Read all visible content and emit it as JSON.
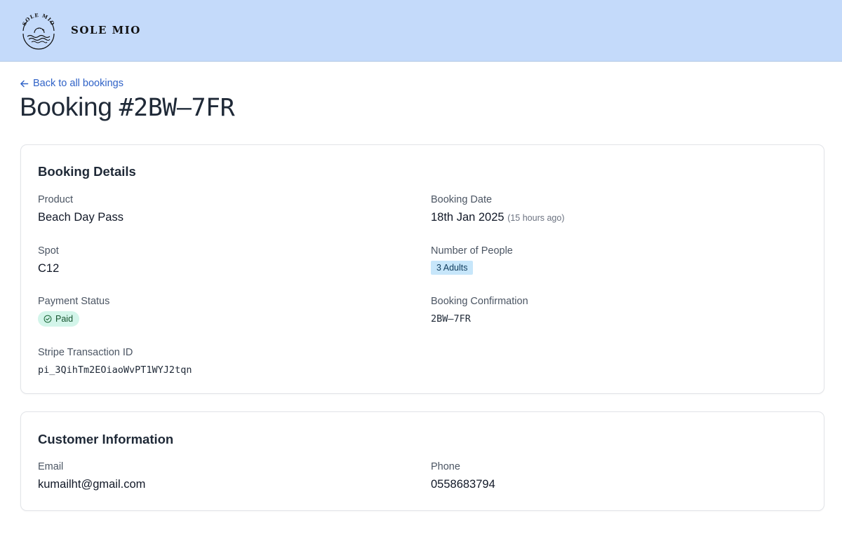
{
  "header": {
    "brand": "SOLE MIO",
    "logo_text": "SOLE MIO"
  },
  "nav": {
    "back_label": "Back to all bookings"
  },
  "page": {
    "title_prefix": "Booking ",
    "title_id": "#2BW–7FR"
  },
  "booking_details": {
    "title": "Booking Details",
    "product_label": "Product",
    "product_value": "Beach Day Pass",
    "booking_date_label": "Booking Date",
    "booking_date_value": "18th Jan 2025",
    "booking_date_relative": "(15 hours ago)",
    "spot_label": "Spot",
    "spot_value": "C12",
    "people_label": "Number of People",
    "people_value": "3 Adults",
    "payment_label": "Payment Status",
    "payment_value": "Paid",
    "confirmation_label": "Booking Confirmation",
    "confirmation_value": "2BW–7FR",
    "stripe_label": "Stripe Transaction ID",
    "stripe_value": "pi_3QihTm2EOiaoWvPT1WYJ2tqn"
  },
  "customer_info": {
    "title": "Customer Information",
    "email_label": "Email",
    "email_value": "kumailht@gmail.com",
    "phone_label": "Phone",
    "phone_value": "0558683794"
  },
  "colors": {
    "header_bg": "#c4dafa",
    "link": "#2f62c7",
    "paid_badge_bg": "#d3f5ea",
    "adults_badge_bg": "#c7e6fa"
  },
  "icons": {
    "back": "arrow-left-icon",
    "paid": "check-circle-icon",
    "logo": "sun-sea-logo"
  }
}
